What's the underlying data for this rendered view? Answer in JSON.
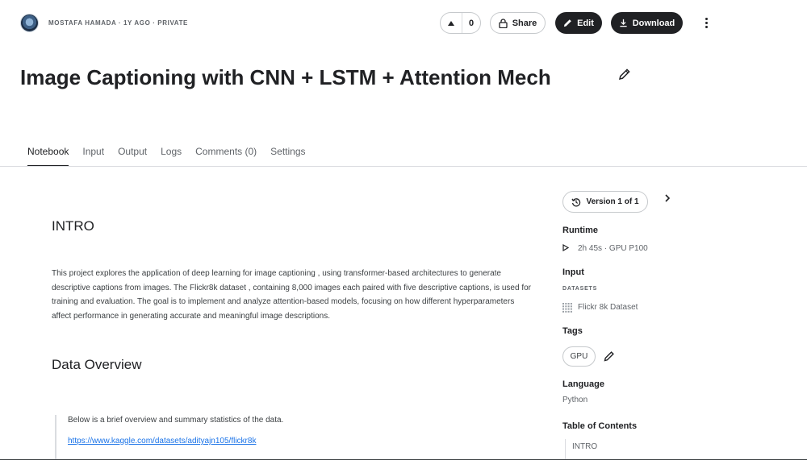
{
  "header": {
    "meta": "MOSTAFA HAMADA · 1Y AGO · PRIVATE",
    "vote_count": "0",
    "share_label": "Share",
    "edit_label": "Edit",
    "download_label": "Download"
  },
  "notebook": {
    "title": "Image Captioning with CNN + LSTM + Attention Mech"
  },
  "tabs": [
    {
      "label": "Notebook"
    },
    {
      "label": "Input"
    },
    {
      "label": "Output"
    },
    {
      "label": "Logs"
    },
    {
      "label": "Comments (0)"
    },
    {
      "label": "Settings"
    }
  ],
  "content": {
    "intro_heading": "INTRO",
    "intro_paragraph": "This project explores the application of deep learning for image captioning , using transformer-based architectures to generate descriptive captions from images. The Flickr8k dataset , containing 8,000 images each paired with five descriptive captions, is used for training and evaluation. The goal is to implement and analyze attention-based models, focusing on how different hyperparameters affect performance in generating accurate and meaningful image descriptions.",
    "data_heading": "Data Overview",
    "quote_text": "Below is a brief overview and summary statistics of the data.",
    "quote_link": "https://www.kaggle.com/datasets/adityajn105/flickr8k"
  },
  "sidebar": {
    "version_label": "Version 1 of 1",
    "runtime_heading": "Runtime",
    "runtime_value": "2h 45s · GPU P100",
    "input_heading": "Input",
    "datasets_label": "DATASETS",
    "dataset_name": "Flickr 8k Dataset",
    "tags_heading": "Tags",
    "tag": "GPU",
    "language_heading": "Language",
    "language_value": "Python",
    "toc_heading": "Table of Contents",
    "toc_item": "INTRO"
  }
}
